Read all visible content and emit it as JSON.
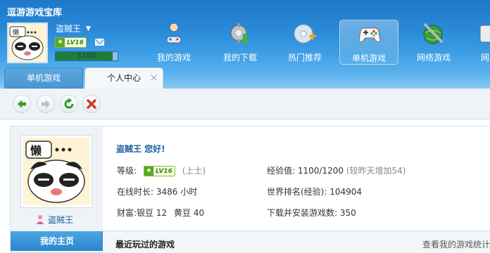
{
  "app": {
    "title": "逗游游戏宝库"
  },
  "user": {
    "name": "盗贼王",
    "level": "LV16",
    "exp_value": "1100",
    "exp_fraction": 0.92
  },
  "nav": [
    {
      "label": "我的游戏",
      "icon": "controller-person-icon"
    },
    {
      "label": "我的下载",
      "icon": "download-gear-icon"
    },
    {
      "label": "热门推荐",
      "icon": "disc-plus-icon"
    },
    {
      "label": "单机游戏",
      "icon": "gamepad-icon"
    },
    {
      "label": "网络游戏",
      "icon": "globe-sword-icon"
    },
    {
      "label": "网",
      "icon": "cut-off-icon"
    }
  ],
  "tabs": [
    {
      "label": "单机游戏"
    },
    {
      "label": "个人中心"
    }
  ],
  "toolbar": {
    "back": "arrow-left-icon",
    "forward": "arrow-right-icon",
    "refresh": "refresh-icon",
    "stop": "close-x-icon"
  },
  "profile": {
    "name": "盗贼王",
    "greeting": "盗贼王  您好!",
    "home_label": "我的主页",
    "level_label": "等级:",
    "level_badge": "LV16",
    "level_title": "(上士)",
    "online_label": "在线时长:",
    "online_value": "3486 小时",
    "wealth_label": "财富:",
    "silver_label": "银豆",
    "silver_value": "12",
    "gold_label": "黄豆",
    "gold_value": "40",
    "exp_label": "经验值:",
    "exp_value": "1100/1200",
    "exp_note": "(较昨天增加54)",
    "rank_label": "世界排名(经验):",
    "rank_value": "104904",
    "downloads_label": "下载并安装游戏数:",
    "downloads_value": "350"
  },
  "recent": {
    "title": "最近玩过的游戏",
    "link": "查看我的游戏统计"
  }
}
